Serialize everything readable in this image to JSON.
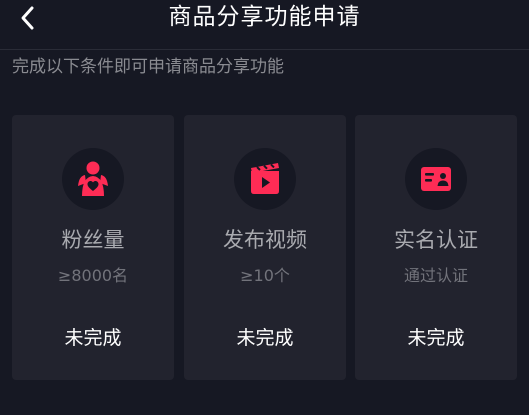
{
  "header": {
    "title": "商品分享功能申请",
    "back_icon": "chevron-left-icon"
  },
  "subtitle": "完成以下条件即可申请商品分享功能",
  "accent_color": "#fe2c55",
  "conditions": [
    {
      "icon": "fans-icon",
      "label": "粉丝量",
      "requirement": "≥8000名",
      "status": "未完成"
    },
    {
      "icon": "video-clapper-icon",
      "label": "发布视频",
      "requirement": "≥10个",
      "status": "未完成"
    },
    {
      "icon": "id-card-icon",
      "label": "实名认证",
      "requirement": "通过认证",
      "status": "未完成"
    }
  ]
}
